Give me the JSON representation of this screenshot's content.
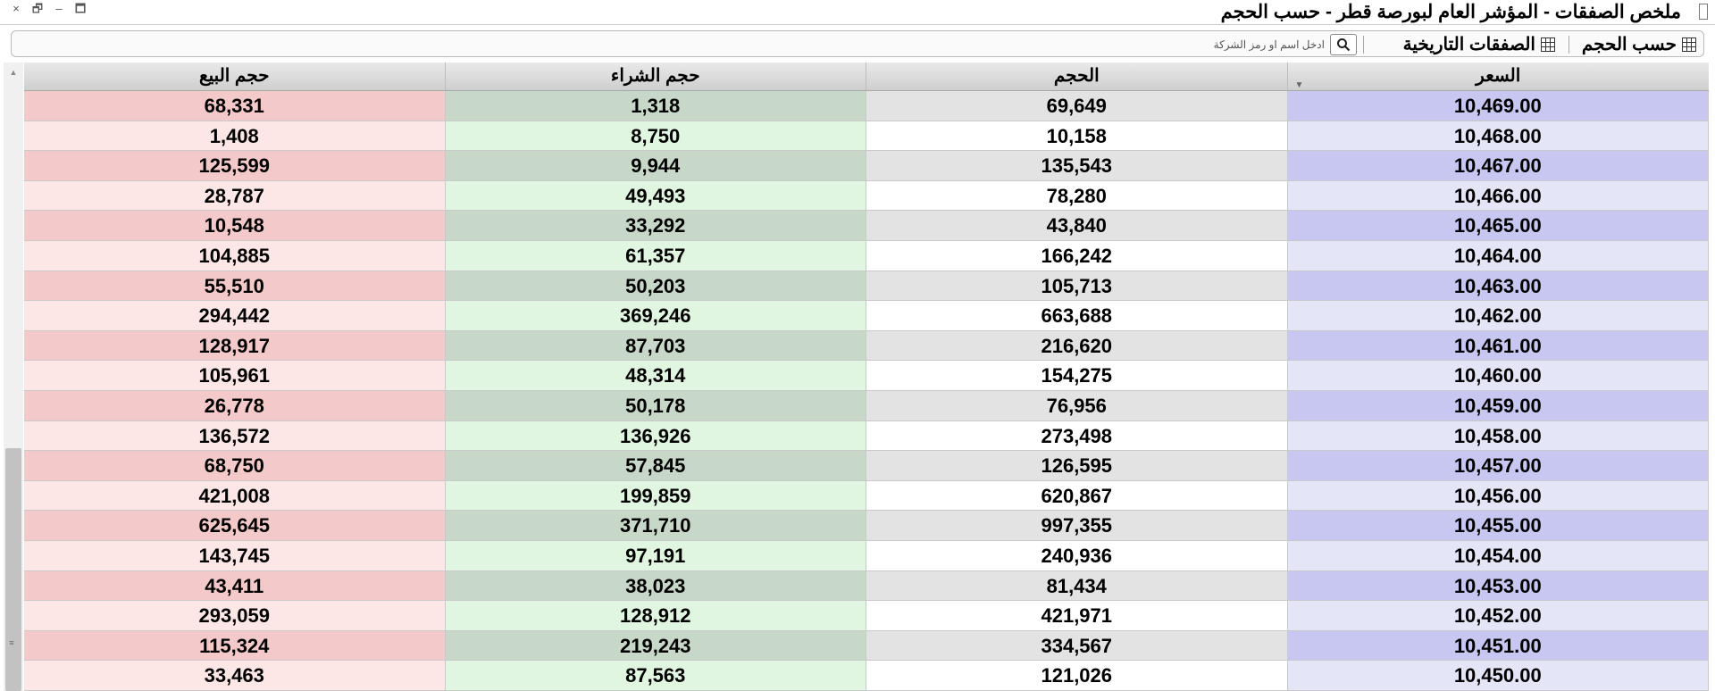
{
  "window": {
    "title": "ملخص الصفقات - المؤشر العام لبورصة قطر - حسب الحجم",
    "controls": {
      "close": "×",
      "restore": "🗗",
      "minimize": "–",
      "maximize": "🗖"
    }
  },
  "toolbar": {
    "by_volume_label": "حسب الحجم",
    "historical_label": "الصفقات التاريخية",
    "search_placeholder": "ادخل اسم او رمز الشركة"
  },
  "table": {
    "columns": {
      "sell": "حجم البيع",
      "buy": "حجم الشراء",
      "volume": "الحجم",
      "price": "السعر"
    },
    "rows": [
      {
        "sell": "68,331",
        "buy": "1,318",
        "volume": "69,649",
        "price": "10,469.00"
      },
      {
        "sell": "1,408",
        "buy": "8,750",
        "volume": "10,158",
        "price": "10,468.00"
      },
      {
        "sell": "125,599",
        "buy": "9,944",
        "volume": "135,543",
        "price": "10,467.00"
      },
      {
        "sell": "28,787",
        "buy": "49,493",
        "volume": "78,280",
        "price": "10,466.00"
      },
      {
        "sell": "10,548",
        "buy": "33,292",
        "volume": "43,840",
        "price": "10,465.00"
      },
      {
        "sell": "104,885",
        "buy": "61,357",
        "volume": "166,242",
        "price": "10,464.00"
      },
      {
        "sell": "55,510",
        "buy": "50,203",
        "volume": "105,713",
        "price": "10,463.00"
      },
      {
        "sell": "294,442",
        "buy": "369,246",
        "volume": "663,688",
        "price": "10,462.00"
      },
      {
        "sell": "128,917",
        "buy": "87,703",
        "volume": "216,620",
        "price": "10,461.00"
      },
      {
        "sell": "105,961",
        "buy": "48,314",
        "volume": "154,275",
        "price": "10,460.00"
      },
      {
        "sell": "26,778",
        "buy": "50,178",
        "volume": "76,956",
        "price": "10,459.00"
      },
      {
        "sell": "136,572",
        "buy": "136,926",
        "volume": "273,498",
        "price": "10,458.00"
      },
      {
        "sell": "68,750",
        "buy": "57,845",
        "volume": "126,595",
        "price": "10,457.00"
      },
      {
        "sell": "421,008",
        "buy": "199,859",
        "volume": "620,867",
        "price": "10,456.00"
      },
      {
        "sell": "625,645",
        "buy": "371,710",
        "volume": "997,355",
        "price": "10,455.00"
      },
      {
        "sell": "143,745",
        "buy": "97,191",
        "volume": "240,936",
        "price": "10,454.00"
      },
      {
        "sell": "43,411",
        "buy": "38,023",
        "volume": "81,434",
        "price": "10,453.00"
      },
      {
        "sell": "293,059",
        "buy": "128,912",
        "volume": "421,971",
        "price": "10,452.00"
      },
      {
        "sell": "115,324",
        "buy": "219,243",
        "volume": "334,567",
        "price": "10,451.00"
      },
      {
        "sell": "33,463",
        "buy": "87,563",
        "volume": "121,026",
        "price": "10,450.00"
      }
    ]
  },
  "colors": {
    "sell_dark": "#f4c9c9",
    "sell_light": "#fde6e6",
    "buy_dark": "#c8d8c8",
    "buy_light": "#e0f6e0",
    "price_dark": "#c7c7f1",
    "price_light": "#e5e5f8"
  },
  "icons": {
    "window_icon": "document-icon",
    "toolbar_by_volume": "grid-icon",
    "toolbar_historical": "calendar-grid-icon",
    "search": "search-icon"
  }
}
